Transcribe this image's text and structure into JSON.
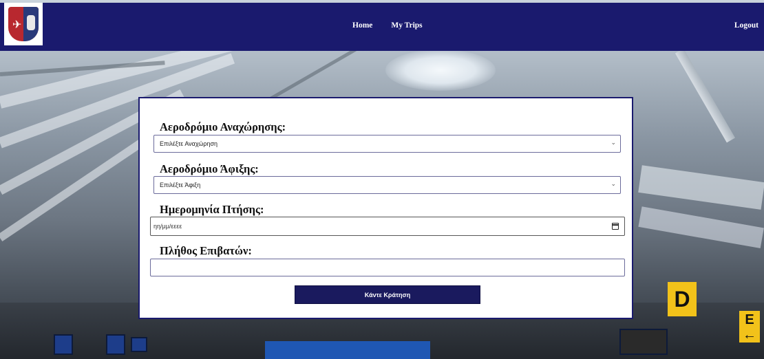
{
  "navbar": {
    "links": [
      {
        "label": "Home"
      },
      {
        "label": "My Trips"
      }
    ],
    "logout_label": "Logout",
    "background": "#1a1a6e"
  },
  "form": {
    "departure": {
      "label": "Αεροδρόμιο Αναχώρησης:",
      "selected": "Επιλέξτε Αναχώρηση"
    },
    "arrival": {
      "label": "Αεροδρόμιο Άφιξης:",
      "selected": "Επιλέξτε Άφιξη"
    },
    "date": {
      "label": "Ημερομηνία Πτήσης:",
      "placeholder": "ηη/μμ/εεεε"
    },
    "passengers": {
      "label": "Πλήθος Επιβατών:",
      "value": ""
    },
    "submit_label": "Κάντε Κράτηση"
  },
  "background_signs": {
    "gate_d": "D",
    "gate_e": "E",
    "gate_e_arrow": "←"
  },
  "colors": {
    "accent": "#1a1a6e",
    "button": "#1a1a5e",
    "sign": "#f2c21a"
  },
  "icons": {
    "chevron": "chevron-down-icon",
    "calendar": "calendar-icon",
    "logo": "airline-logo"
  }
}
